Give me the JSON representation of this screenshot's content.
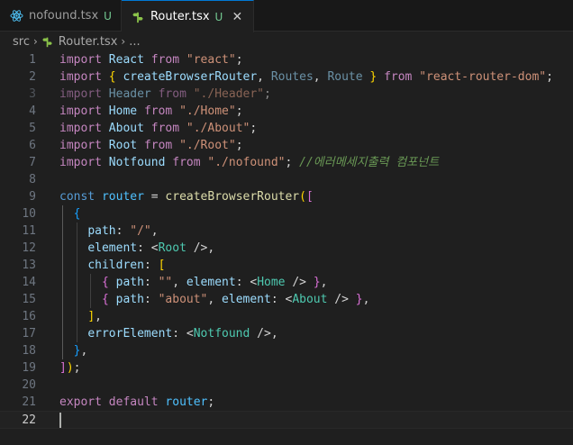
{
  "tabs": [
    {
      "label": "nofound.tsx",
      "badge": "U",
      "icon": "react-icon",
      "active": false
    },
    {
      "label": "Router.tsx",
      "badge": "U",
      "icon": "router-icon",
      "active": true,
      "close": "✕"
    }
  ],
  "breadcrumb": {
    "folder": "src",
    "file": "Router.tsx",
    "more": "..."
  },
  "editor": {
    "current_line": 22,
    "lines": [
      {
        "n": "1"
      },
      {
        "n": "2"
      },
      {
        "n": "3"
      },
      {
        "n": "4"
      },
      {
        "n": "5"
      },
      {
        "n": "6"
      },
      {
        "n": "7"
      },
      {
        "n": "8"
      },
      {
        "n": "9"
      },
      {
        "n": "10"
      },
      {
        "n": "11"
      },
      {
        "n": "12"
      },
      {
        "n": "13"
      },
      {
        "n": "14"
      },
      {
        "n": "15"
      },
      {
        "n": "16"
      },
      {
        "n": "17"
      },
      {
        "n": "18"
      },
      {
        "n": "19"
      },
      {
        "n": "20"
      },
      {
        "n": "21"
      },
      {
        "n": "22"
      }
    ],
    "t": {
      "import": "import",
      "from": "from",
      "const": "const",
      "export": "export",
      "default": "default",
      "React": "React",
      "createBrowserRouter": "createBrowserRouter",
      "Routes": "Routes",
      "Route": "Route",
      "Header": "Header",
      "Home": "Home",
      "About": "About",
      "Root": "Root",
      "Notfound": "Notfound",
      "router": "router",
      "path": "path",
      "element": "element",
      "children": "children",
      "errorElement": "errorElement",
      "s_react": "\"react\"",
      "s_rrd": "\"react-router-dom\"",
      "s_header": "\"./Header\"",
      "s_home": "\"./Home\"",
      "s_about": "\"./About\"",
      "s_root": "\"./Root\"",
      "s_nofound": "\"./nofound\"",
      "s_slash": "\"/\"",
      "s_empty": "\"\"",
      "s_about2": "\"about\"",
      "comment": "//에러메세지출력 컴포넌트"
    }
  },
  "colors": {
    "background": "#1f1f1f",
    "accent": "#0078d4",
    "untracked": "#73c991"
  }
}
